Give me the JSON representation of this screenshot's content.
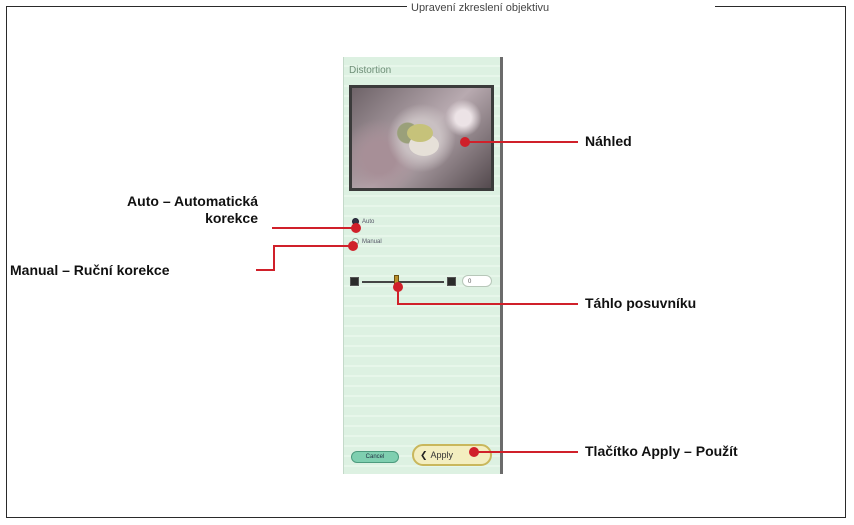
{
  "page": {
    "top_caption": "Upravení zkreslení objektivu"
  },
  "panel": {
    "title": "Distortion",
    "radio_auto": "Auto",
    "radio_manual": "Manual",
    "slider_value": "0",
    "cancel_label": "Cancel",
    "apply_label": "Apply",
    "apply_chevron": "❮"
  },
  "callouts": {
    "preview": "Náhled",
    "auto_line1": "Auto – Automatická",
    "auto_line2": "korekce",
    "manual": "Manual – Ruční korekce",
    "slider_thumb": "Táhlo posuvníku",
    "apply": "Tlačítko Apply – Použít"
  },
  "colors": {
    "callout_line": "#d0202a",
    "panel_bg": "#ddf1e2"
  }
}
